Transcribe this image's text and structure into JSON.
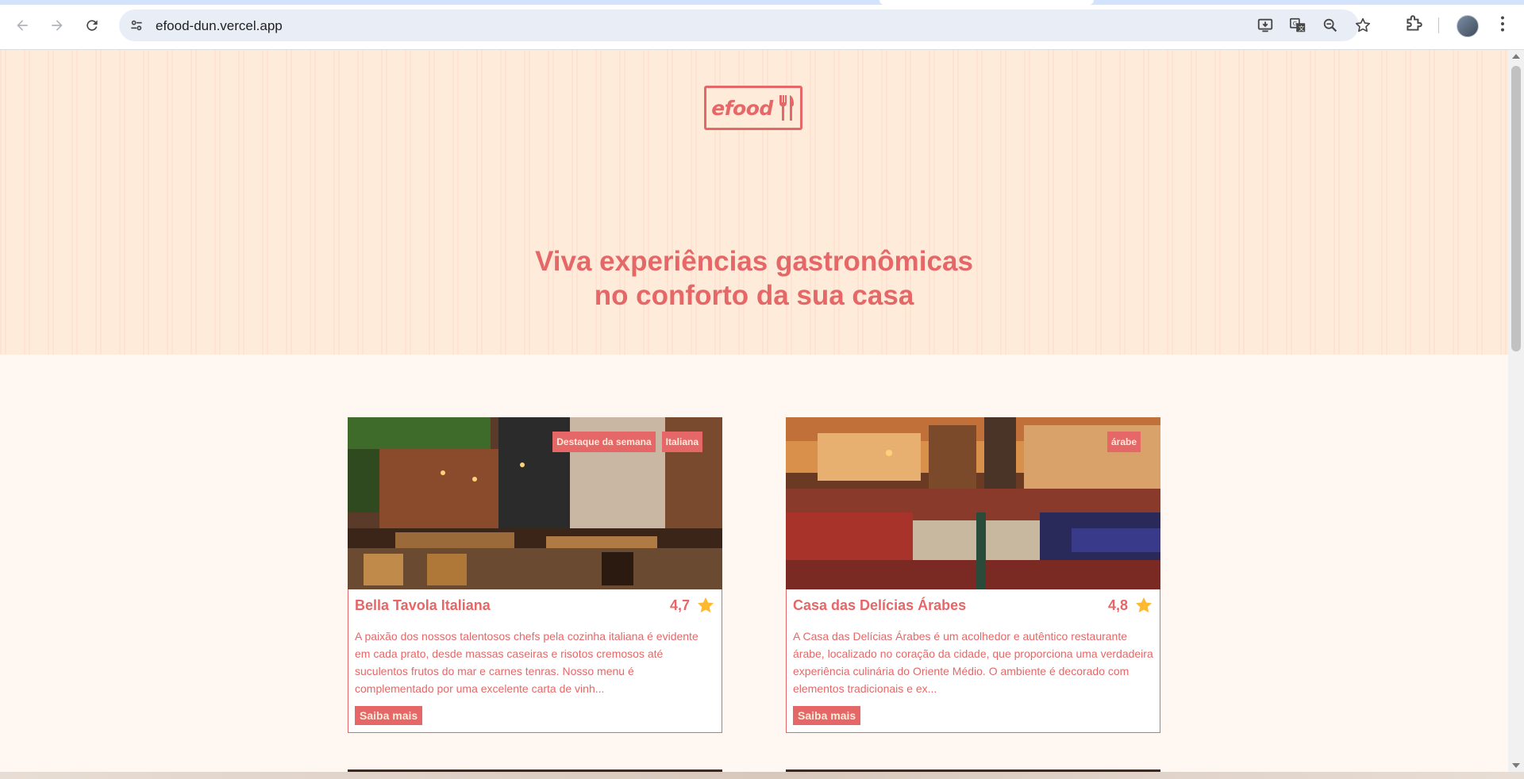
{
  "browser": {
    "url": "efood-dun.vercel.app",
    "icons": {
      "back": "back-arrow-icon",
      "forward": "forward-arrow-icon",
      "reload": "reload-icon",
      "site_settings": "tune-icon",
      "install": "install-app-icon",
      "translate": "translate-icon",
      "zoom": "zoom-icon",
      "bookmark": "star-outline-icon",
      "extensions": "puzzle-icon",
      "menu": "kebab-menu-icon"
    }
  },
  "brand": {
    "logo_text": "efood",
    "accent": "#e66767",
    "hero_bg": "#ffebd9",
    "page_bg": "#fff8f2"
  },
  "hero": {
    "title_line1": "Viva experiências gastronômicas",
    "title_line2": "no conforto da sua casa"
  },
  "restaurants": [
    {
      "name": "Bella Tavola Italiana",
      "rating": "4,7",
      "tags": [
        "Destaque da semana",
        "Italiana"
      ],
      "description": "A paixão dos nossos talentosos chefs pela cozinha italiana é evidente em cada prato, desde massas caseiras e risotos cremosos até suculentos frutos do mar e carnes tenras. Nosso menu é complementado por uma excelente carta de vinh...",
      "button": "Saiba mais"
    },
    {
      "name": "Casa das Delícias Árabes",
      "rating": "4,8",
      "tags": [
        "árabe"
      ],
      "description": "A Casa das Delícias Árabes é um acolhedor e autêntico restaurante árabe, localizado no coração da cidade, que proporciona uma verdadeira experiência culinária do Oriente Médio. O ambiente é decorado com elementos tradicionais e ex...",
      "button": "Saiba mais"
    }
  ]
}
